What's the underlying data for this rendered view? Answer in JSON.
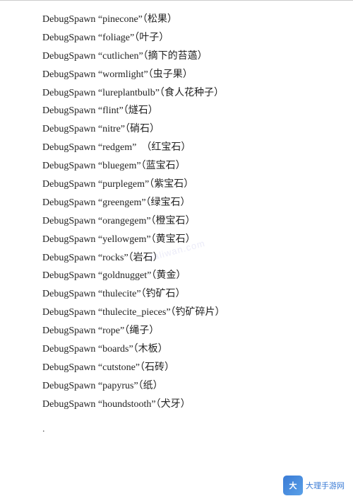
{
  "divider": true,
  "watermark": "daliwan.com",
  "lines": [
    {
      "text": "DebugSpawn “pinecone”（松果）"
    },
    {
      "text": "DebugSpawn “foliage”（叶子）"
    },
    {
      "text": "DebugSpawn “cutlichen”（摘下的苔薖）"
    },
    {
      "text": "DebugSpawn “wormlight”（虫子果）"
    },
    {
      "text": "DebugSpawn “lureplantbulb”（食人花种子）"
    },
    {
      "text": "DebugSpawn “flint”（燧石）"
    },
    {
      "text": "DebugSpawn “nitre”（硝石）"
    },
    {
      "text": "DebugSpawn “redgem”　（红宝石）"
    },
    {
      "text": "DebugSpawn “bluegem”（蓝宝石）"
    },
    {
      "text": "DebugSpawn “purplegem”（紫宝石）"
    },
    {
      "text": "DebugSpawn “greengem”（绿宝石）"
    },
    {
      "text": "DebugSpawn “orangegem”（橙宝石）"
    },
    {
      "text": "DebugSpawn “yellowgem”（黄宝石）"
    },
    {
      "text": "DebugSpawn “rocks”（岩石）"
    },
    {
      "text": "DebugSpawn “goldnugget”（黄金）"
    },
    {
      "text": "DebugSpawn “thulecite”（钓矿石）"
    },
    {
      "text": "DebugSpawn “thulecite_pieces”（钓矿碎片）"
    },
    {
      "text": "DebugSpawn “rope”（绳子）"
    },
    {
      "text": "DebugSpawn “boards”（木板）"
    },
    {
      "text": "DebugSpawn “cutstone”（石砖）"
    },
    {
      "text": "DebugSpawn “papyrus”（纸）"
    },
    {
      "text": "DebugSpawn “houndstooth”（犬牙）"
    }
  ],
  "bottom_dot": ".",
  "logo": {
    "icon_text": "大",
    "label": "大理手游网"
  }
}
